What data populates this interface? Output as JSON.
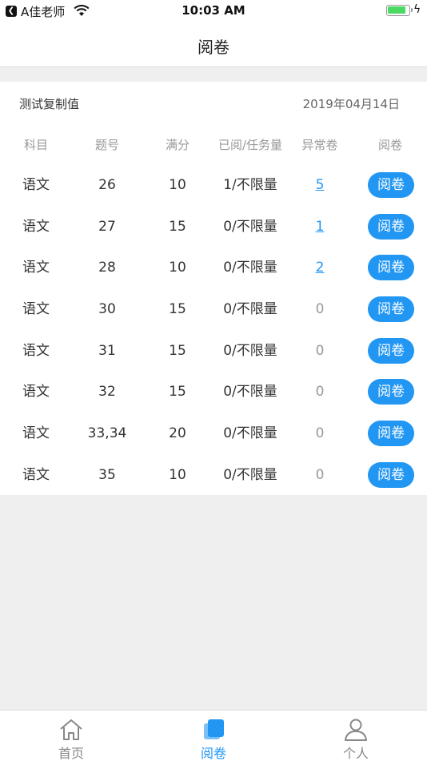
{
  "status_bar": {
    "app_name": "A佳老师",
    "time": "10:03 AM"
  },
  "nav": {
    "title": "阅卷"
  },
  "card": {
    "name": "测试复制值",
    "date": "2019年04月14日"
  },
  "table": {
    "headers": {
      "subject": "科目",
      "question_no": "题号",
      "full_score": "满分",
      "read_task": "已阅/任务量",
      "abnormal": "异常卷",
      "action": "阅卷"
    },
    "rows": [
      {
        "subject": "语文",
        "question_no": "26",
        "full_score": "10",
        "read_task": "1/不限量",
        "abnormal": "5",
        "action": "阅卷"
      },
      {
        "subject": "语文",
        "question_no": "27",
        "full_score": "15",
        "read_task": "0/不限量",
        "abnormal": "1",
        "action": "阅卷"
      },
      {
        "subject": "语文",
        "question_no": "28",
        "full_score": "10",
        "read_task": "0/不限量",
        "abnormal": "2",
        "action": "阅卷"
      },
      {
        "subject": "语文",
        "question_no": "30",
        "full_score": "15",
        "read_task": "0/不限量",
        "abnormal": "0",
        "action": "阅卷"
      },
      {
        "subject": "语文",
        "question_no": "31",
        "full_score": "15",
        "read_task": "0/不限量",
        "abnormal": "0",
        "action": "阅卷"
      },
      {
        "subject": "语文",
        "question_no": "32",
        "full_score": "15",
        "read_task": "0/不限量",
        "abnormal": "0",
        "action": "阅卷"
      },
      {
        "subject": "语文",
        "question_no": "33,34",
        "full_score": "20",
        "read_task": "0/不限量",
        "abnormal": "0",
        "action": "阅卷"
      },
      {
        "subject": "语文",
        "question_no": "35",
        "full_score": "10",
        "read_task": "0/不限量",
        "abnormal": "0",
        "action": "阅卷"
      }
    ]
  },
  "tab_bar": {
    "tabs": [
      {
        "label": "首页",
        "icon": "home-icon"
      },
      {
        "label": "阅卷",
        "icon": "review-icon",
        "active": true
      },
      {
        "label": "个人",
        "icon": "person-icon"
      }
    ]
  },
  "colors": {
    "accent": "#2196f3",
    "background": "#efefef",
    "muted": "#999999"
  }
}
